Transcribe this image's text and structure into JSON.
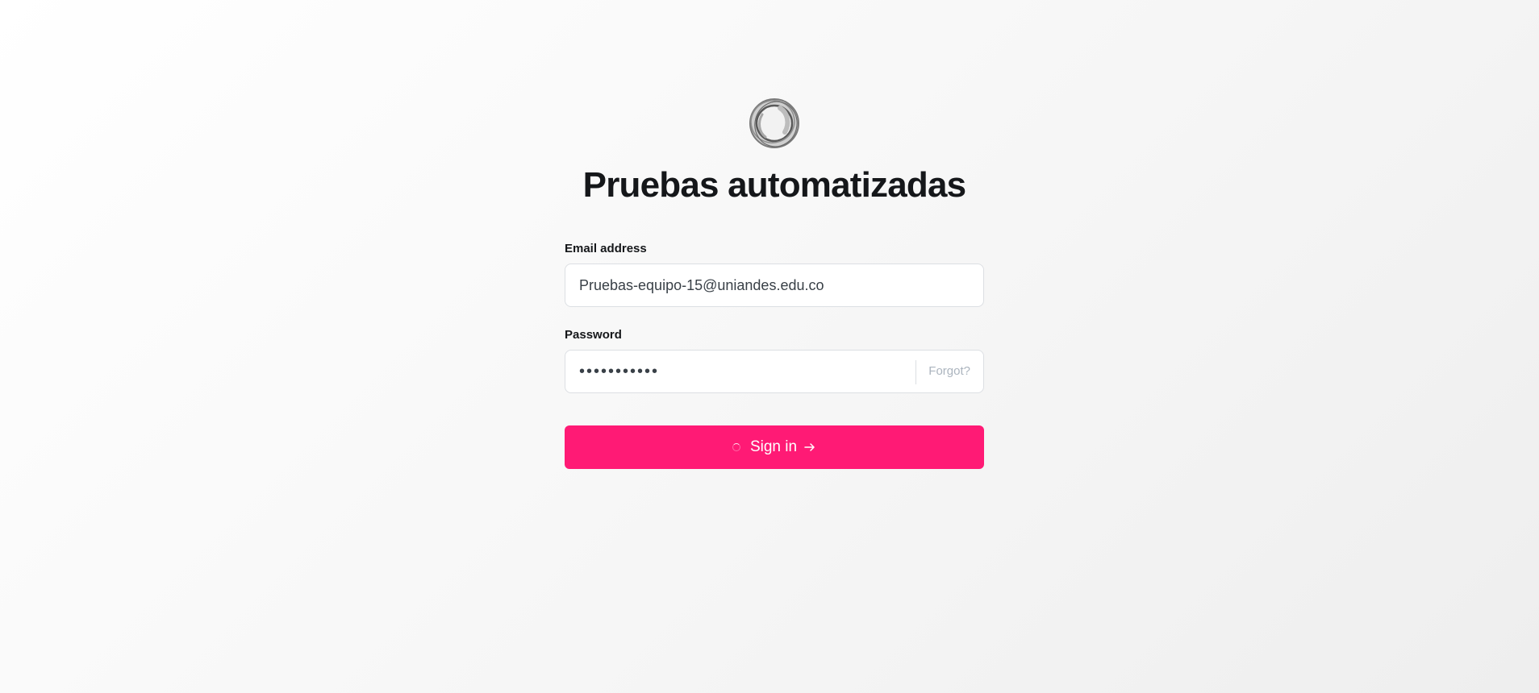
{
  "site": {
    "title": "Pruebas automatizadas",
    "logo_icon": "site-logo-icon"
  },
  "form": {
    "email": {
      "label": "Email address",
      "value": "Pruebas-equipo-15@uniandes.edu.co",
      "placeholder": ""
    },
    "password": {
      "label": "Password",
      "value": "•••••••••••",
      "forgot_label": "Forgot?"
    },
    "submit": {
      "label": "Sign in",
      "loading": true,
      "icons": [
        "spinner-icon",
        "arrow-right-icon"
      ]
    }
  },
  "colors": {
    "accent": "#ff1a75",
    "text": "#15171a",
    "muted": "#abb4be",
    "border": "#dcdfe3"
  }
}
